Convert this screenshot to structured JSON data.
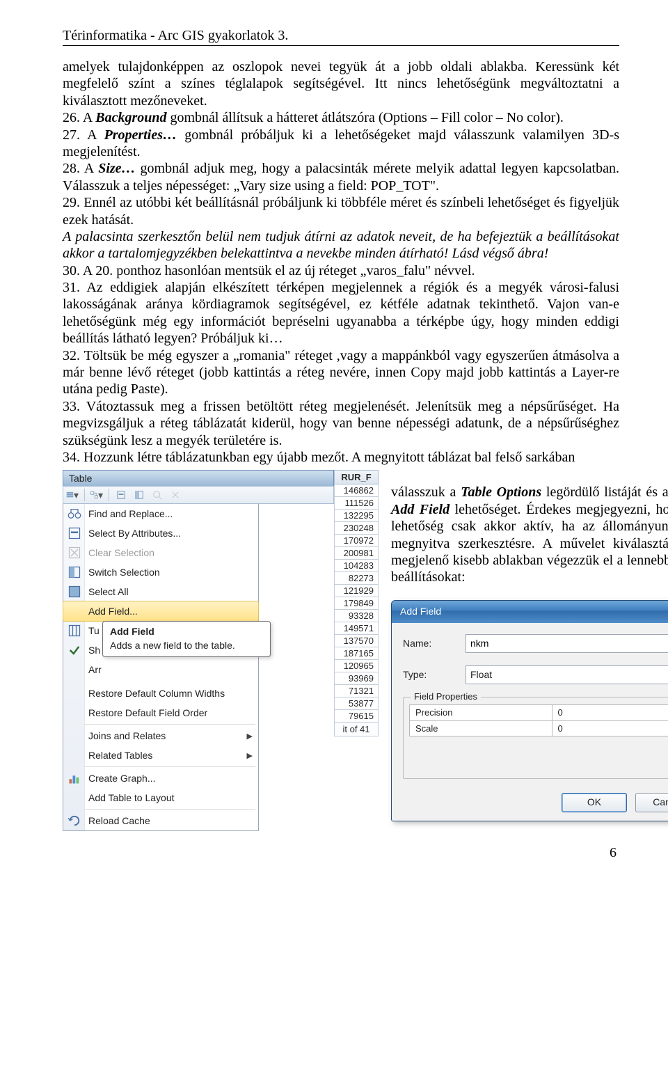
{
  "header": "Térinformatika - Arc GIS gyakorlatok 3.",
  "page_number": "6",
  "paragraphs": {
    "p1": "amelyek tulajdonképpen az oszlopok nevei tegyük át a jobb oldali ablakba. Keressünk két megfelelő színt a színes téglalapok segítségével. Itt nincs lehetőségünk megváltoztatni a kiválasztott mezőneveket.",
    "p2a": "26. A ",
    "p2b": "Background",
    "p2c": " gombnál állítsuk a hátteret átlátszóra (Options – Fill color – No color).",
    "p3a": "27. A ",
    "p3b": "Properties…",
    "p3c": " gombnál próbáljuk ki a lehetőségeket majd válasszunk valamilyen 3D-s megjelenítést.",
    "p4a": "28. A ",
    "p4b": "Size…",
    "p4c": " gombnál adjuk meg, hogy a palacsinták mérete melyik adattal legyen kapcsolatban. Válasszuk a teljes népességet: „Vary size using a field: POP_TOT\".",
    "p5": "29. Ennél az utóbbi két beállításnál próbáljunk ki többféle méret és színbeli lehetőséget és figyeljük ezek hatását.",
    "p6": "A palacsinta szerkesztőn belül nem tudjuk átírni az adatok neveit, de ha befejeztük a beállításokat akkor a tartalomjegyzékben belekattintva a nevekbe minden átírható! Lásd végső ábra!",
    "p7": "30. A 20. ponthoz hasonlóan mentsük el az új réteget „varos_falu\" névvel.",
    "p8": "31. Az eddigiek alapján elkészített térképen megjelennek a régiók és a megyék városi-falusi lakosságának aránya kördiagramok segítségével, ez kétféle adatnak tekinthető. Vajon van-e lehetőségünk még egy információt bepréselni ugyanabba a térképbe úgy, hogy minden eddigi beállítás látható legyen? Próbáljuk ki…",
    "p9": "32. Töltsük be még egyszer a „romania\" réteget ,vagy a mappánkból vagy egyszerűen átmásolva a már benne lévő réteget (jobb kattintás a réteg nevére, innen Copy majd jobb kattintás a Layer-re utána pedig Paste).",
    "p10": "33. Vátoztassuk meg a frissen betöltött réteg megjelenését. Jelenítsük meg a népsűrűséget. Ha megvizsgáljuk a réteg táblázatát kiderül, hogy van benne népességi adatunk, de a népsűrűséghez szükségünk lesz a megyék területére is.",
    "p11": "34. Hozzunk létre táblázatunkban egy újabb mezőt. A megnyitott táblázat bal felső sarkában ",
    "right1a": "válasszuk a ",
    "right1b": "Table Options",
    "right1c": " legördülő listáját és abban az ",
    "right1d": "Add Field",
    "right1e": " lehetőséget. Érdekes megjegyezni, hogy ez a lehetőség csak akkor aktív, ha az állományunk nincs megnyitva szerkesztésre. A művelet kiválasztása után megjelenő kisebb ablakban végezzük el a lennebb látható beállításokat:"
  },
  "table_panel": {
    "title": "Table",
    "column_header": "RUR_F",
    "values": [
      "146862",
      "111526",
      "132295",
      "230248",
      "170972",
      "200981",
      "104283",
      "82273",
      "121929",
      "179849",
      "93328",
      "149571",
      "137570",
      "187165",
      "120965",
      "93969",
      "71321",
      "53877",
      "79615"
    ],
    "footer": "it of 41",
    "menu": [
      {
        "icon": "binoculars",
        "label": "Find and Replace..."
      },
      {
        "icon": "select-attr",
        "label": "Select By Attributes..."
      },
      {
        "icon": "clear-sel",
        "label": "Clear Selection",
        "disabled": true
      },
      {
        "icon": "switch-sel",
        "label": "Switch Selection"
      },
      {
        "icon": "select-all",
        "label": "Select All"
      },
      {
        "icon": "",
        "label": "Add Field...",
        "highlight": true
      },
      {
        "icon": "fields",
        "label": "Tu"
      },
      {
        "icon": "check",
        "label": "Sh"
      },
      {
        "icon": "",
        "label": "Arr"
      },
      {
        "icon": "",
        "label": "Restore Default Column Widths"
      },
      {
        "icon": "",
        "label": "Restore Default Field Order"
      },
      {
        "icon": "",
        "label": "Joins and Relates",
        "arrow": true
      },
      {
        "icon": "",
        "label": "Related Tables",
        "arrow": true
      },
      {
        "icon": "graph",
        "label": "Create Graph..."
      },
      {
        "icon": "",
        "label": "Add Table to Layout"
      },
      {
        "icon": "reload",
        "label": "Reload Cache"
      }
    ],
    "tooltip": {
      "title": "Add Field",
      "body": "Adds a new field to the table."
    }
  },
  "dialog": {
    "title": "Add Field",
    "name_label": "Name:",
    "name_value": "nkm",
    "type_label": "Type:",
    "type_value": "Float",
    "field_props_legend": "Field Properties",
    "props": [
      {
        "k": "Precision",
        "v": "0"
      },
      {
        "k": "Scale",
        "v": "0"
      }
    ],
    "ok": "OK",
    "cancel": "Cancel"
  }
}
